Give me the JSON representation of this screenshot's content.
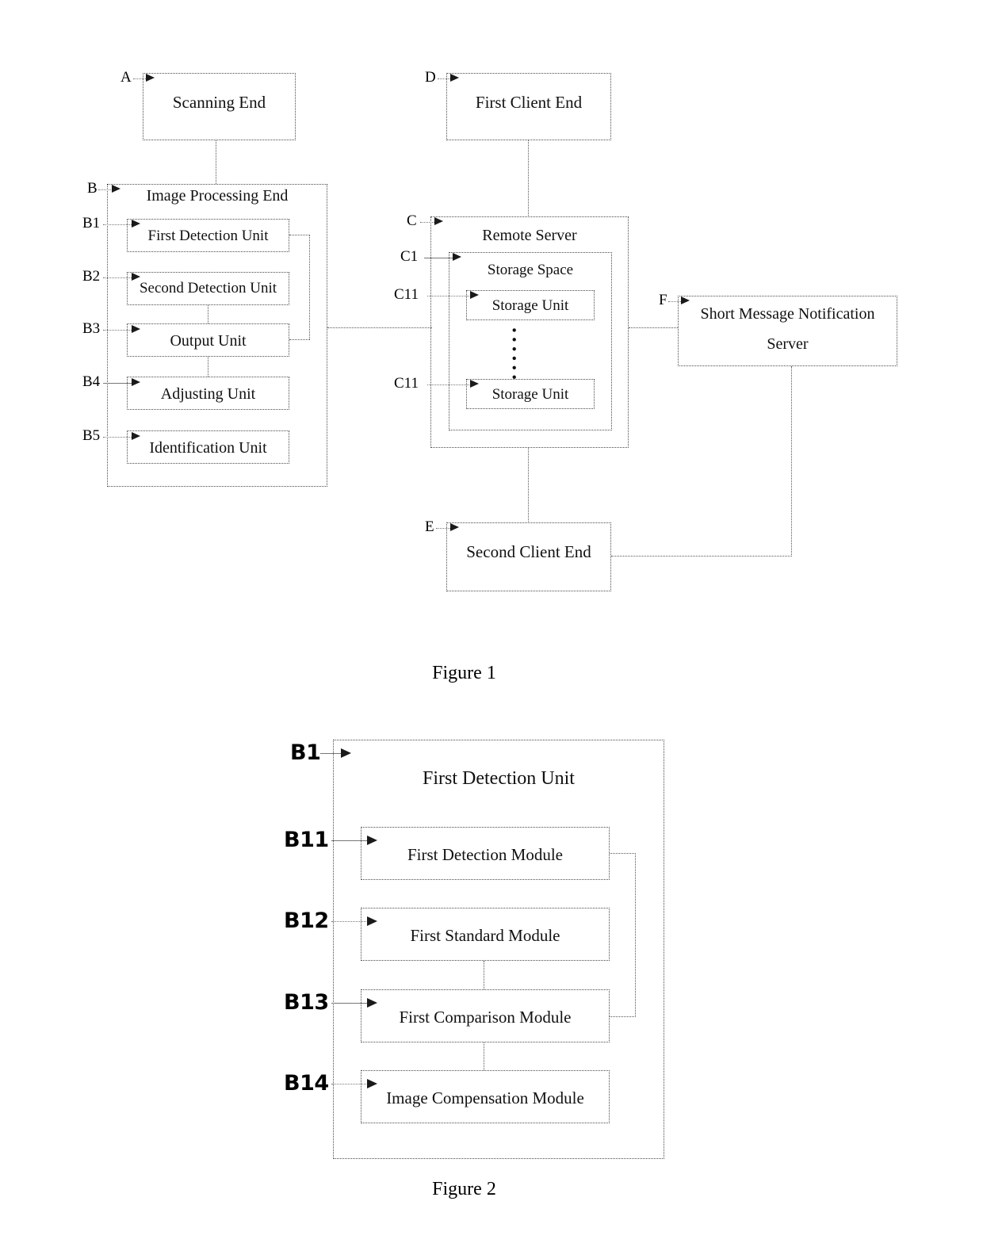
{
  "figure1": {
    "caption": "Figure 1",
    "nodes": {
      "scanning_end": {
        "label": "Scanning End",
        "ref": "A"
      },
      "first_client_end": {
        "label": "First Client End",
        "ref": "D"
      },
      "image_processing_end": {
        "label": "Image Processing End",
        "ref": "B"
      },
      "first_detection_unit": {
        "label": "First Detection Unit",
        "ref": "B1"
      },
      "second_detection_unit": {
        "label": "Second Detection Unit",
        "ref": "B2"
      },
      "output_unit": {
        "label": "Output Unit",
        "ref": "B3"
      },
      "adjusting_unit": {
        "label": "Adjusting Unit",
        "ref": "B4"
      },
      "identification_unit": {
        "label": "Identification Unit",
        "ref": "B5"
      },
      "remote_server": {
        "label": "Remote Server",
        "ref": "C"
      },
      "storage_space": {
        "label": "Storage Space",
        "ref": "C1"
      },
      "storage_unit_top": {
        "label": "Storage Unit",
        "ref": "C11"
      },
      "storage_unit_bottom": {
        "label": "Storage Unit",
        "ref": "C11"
      },
      "sms_server": {
        "label_line1": "Short Message Notification",
        "label_line2": "Server",
        "ref": "F"
      },
      "second_client_end": {
        "label": "Second Client End",
        "ref": "E"
      }
    },
    "ellipsis": "••••••"
  },
  "figure2": {
    "caption": "Figure 2",
    "nodes": {
      "first_detection_unit": {
        "label": "First Detection Unit",
        "ref": "B1"
      },
      "first_detection_module": {
        "label": "First Detection Module",
        "ref": "B11"
      },
      "first_standard_module": {
        "label": "First Standard Module",
        "ref": "B12"
      },
      "first_comparison_module": {
        "label": "First Comparison Module",
        "ref": "B13"
      },
      "image_compensation_module": {
        "label": "Image Compensation Module",
        "ref": "B14"
      }
    }
  },
  "colors": {
    "ink": "#000000",
    "line": "#555555",
    "paper": "#ffffff"
  }
}
